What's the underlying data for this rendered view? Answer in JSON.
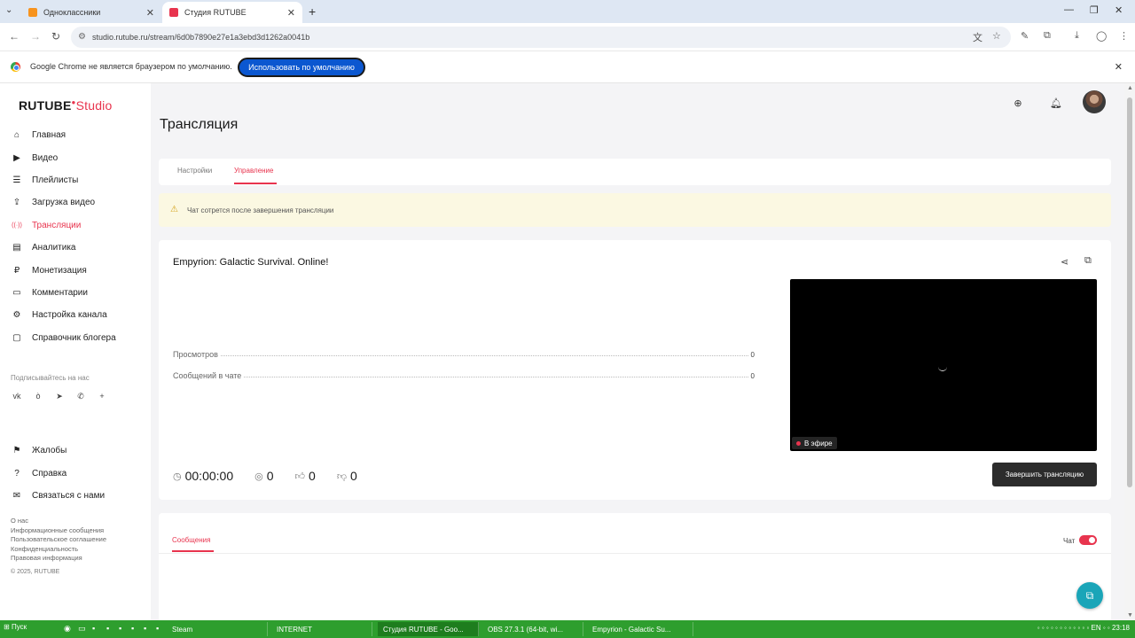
{
  "browser": {
    "tabs": [
      {
        "title": "Одноклассники",
        "favicon_color": "#f7931e"
      },
      {
        "title": "Студия RUTUBE",
        "favicon_color": "#e8344e"
      }
    ],
    "url": "studio.rutube.ru/stream/6d0b7890e27e1a3ebd3d1262a0041b",
    "infobar_text": "Google Chrome не является браузером по умолчанию.",
    "infobar_button": "Использовать по умолчанию"
  },
  "app": {
    "logo_main": "RUTUBE",
    "logo_accent": "Studio",
    "accent_color": "#e8344e"
  },
  "sidebar": {
    "items": [
      {
        "label": "Главная",
        "icon": "home-icon",
        "glyph": "⌂"
      },
      {
        "label": "Видео",
        "icon": "video-icon",
        "glyph": "▶"
      },
      {
        "label": "Плейлисты",
        "icon": "playlist-icon",
        "glyph": "☰"
      },
      {
        "label": "Загрузка видео",
        "icon": "upload-icon",
        "glyph": "⇪"
      },
      {
        "label": "Трансляции",
        "icon": "broadcast-icon",
        "glyph": "((·))",
        "active": true
      },
      {
        "label": "Аналитика",
        "icon": "analytics-icon",
        "glyph": "▤"
      },
      {
        "label": "Монетизация",
        "icon": "monetization-icon",
        "glyph": "₽"
      },
      {
        "label": "Комментарии",
        "icon": "comments-icon",
        "glyph": "▭"
      },
      {
        "label": "Настройка канала",
        "icon": "settings-icon",
        "glyph": "⚙"
      },
      {
        "label": "Справочник блогера",
        "icon": "handbook-icon",
        "glyph": "▢"
      }
    ],
    "subscribe_label": "Подписывайтесь на нас",
    "social": [
      {
        "icon": "vk-icon",
        "glyph": "vk"
      },
      {
        "icon": "ok-icon",
        "glyph": "ò"
      },
      {
        "icon": "telegram-icon",
        "glyph": "➤"
      },
      {
        "icon": "viber-icon",
        "glyph": "✆"
      },
      {
        "icon": "more-icon",
        "glyph": "+"
      }
    ],
    "secondary": [
      {
        "label": "Жалобы",
        "icon": "flag-icon",
        "glyph": "⚑"
      },
      {
        "label": "Справка",
        "icon": "help-icon",
        "glyph": "?"
      },
      {
        "label": "Связаться с нами",
        "icon": "mail-icon",
        "glyph": "✉"
      }
    ],
    "footer_links": [
      "О нас",
      "Информационные сообщения",
      "Пользовательское соглашение",
      "Конфиденциальность",
      "Правовая информация"
    ],
    "copyright": "© 2025, RUTUBE"
  },
  "page": {
    "title": "Трансляция",
    "tabs": [
      "Настройки",
      "Управление"
    ],
    "active_tab": "Управление",
    "warning": "Чат сотрется после завершения трансляции"
  },
  "stream": {
    "title": "Empyrion: Galactic Survival. Online!",
    "stats": [
      {
        "label": "Просмотров",
        "value": "0"
      },
      {
        "label": "Сообщений в чате",
        "value": "0"
      }
    ],
    "live_badge": "В эфире",
    "duration": "00:00:00",
    "viewers": "0",
    "likes": "0",
    "dislikes": "0",
    "end_button": "Завершить трансляцию"
  },
  "chat": {
    "tab": "Сообщения",
    "toggle_label": "Чат",
    "enabled": true
  },
  "taskbar": {
    "start": "Пуск",
    "tasks": [
      "Steam",
      "INTERNET",
      "Студия RUTUBE - Goo...",
      "OBS 27.3.1 (64-bit, wi...",
      "Empyrion - Galactic Su..."
    ],
    "active_task": "Студия RUTUBE - Goo...",
    "lang": "EN",
    "time": "23:18"
  }
}
